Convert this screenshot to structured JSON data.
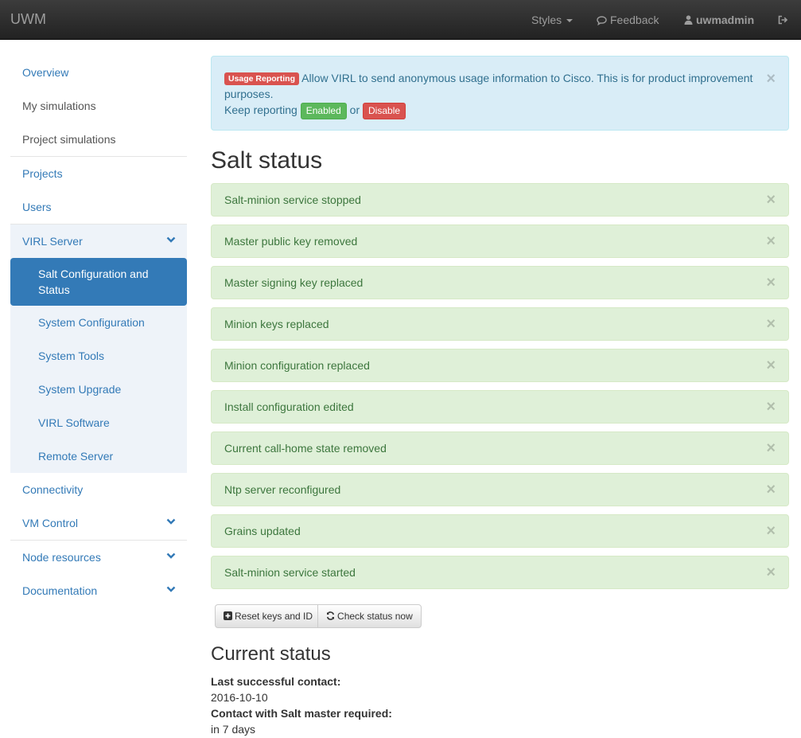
{
  "navbar": {
    "brand": "UWM",
    "styles_label": "Styles",
    "feedback_label": "Feedback",
    "user_label": "uwmadmin"
  },
  "sidebar": {
    "items": [
      {
        "label": "Overview"
      },
      {
        "label": "My simulations"
      },
      {
        "label": "Project simulations"
      },
      {
        "label": "Projects"
      },
      {
        "label": "Users"
      },
      {
        "label": "VIRL Server"
      },
      {
        "label": "Salt Configuration and Status"
      },
      {
        "label": "System Configuration"
      },
      {
        "label": "System Tools"
      },
      {
        "label": "System Upgrade"
      },
      {
        "label": "VIRL Software"
      },
      {
        "label": "Remote Server"
      },
      {
        "label": "Connectivity"
      },
      {
        "label": "VM Control"
      },
      {
        "label": "Node resources"
      },
      {
        "label": "Documentation"
      }
    ]
  },
  "usage_alert": {
    "badge": "Usage Reporting",
    "message": "Allow VIRL to send anonymous usage information to Cisco. This is for product improvement purposes.",
    "keep_reporting": "Keep reporting",
    "enabled_label": "Enabled",
    "or_text": "or",
    "disable_label": "Disable"
  },
  "page_title": "Salt status",
  "status_alerts": [
    "Salt-minion service stopped",
    "Master public key removed",
    "Master signing key replaced",
    "Minion keys replaced",
    "Minion configuration replaced",
    "Install configuration edited",
    "Current call-home state removed",
    "Ntp server reconfigured",
    "Grains updated",
    "Salt-minion service started"
  ],
  "actions": {
    "reset_label": "Reset keys and ID",
    "check_label": "Check status now"
  },
  "current_status": {
    "heading": "Current status",
    "last_contact_label": "Last successful contact:",
    "last_contact_value": "2016-10-10",
    "required_label": "Contact with Salt master required:",
    "required_value": "in 7 days"
  },
  "close_glyph": "×",
  "colors": {
    "navbar_bg": "#222222",
    "link": "#337ab7",
    "active_bg": "#337ab7",
    "success_bg": "#dff0d8",
    "info_bg": "#d9edf7",
    "danger": "#d9534f",
    "success_btn": "#5cb85c"
  }
}
